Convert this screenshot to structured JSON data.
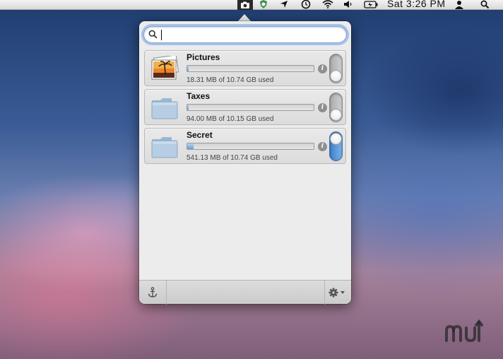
{
  "menubar": {
    "clock": "Sat 3:26 PM",
    "icons": [
      "camera-icon",
      "shield-icon",
      "location-arrow-icon",
      "time-machine-icon",
      "wifi-icon",
      "volume-icon",
      "battery-icon",
      "user-icon",
      "spotlight-icon"
    ]
  },
  "search": {
    "value": "",
    "placeholder": ""
  },
  "volumes": [
    {
      "name": "Pictures",
      "usage": "18.31 MB of 10.74 GB used",
      "used_fraction": 0.0017,
      "icon": "pictures-icon",
      "mounted": false
    },
    {
      "name": "Taxes",
      "usage": "94.00 MB of 10.15 GB used",
      "used_fraction": 0.009,
      "icon": "folder-icon",
      "mounted": false
    },
    {
      "name": "Secret",
      "usage": "541.13 MB of 10.74 GB used",
      "used_fraction": 0.05,
      "icon": "folder-icon",
      "mounted": true
    }
  ],
  "footer": {
    "left_icon": "anchor-icon",
    "right_icon": "gear-icon"
  },
  "colors": {
    "accent": "#5a93d6",
    "popover": "#ececec"
  }
}
